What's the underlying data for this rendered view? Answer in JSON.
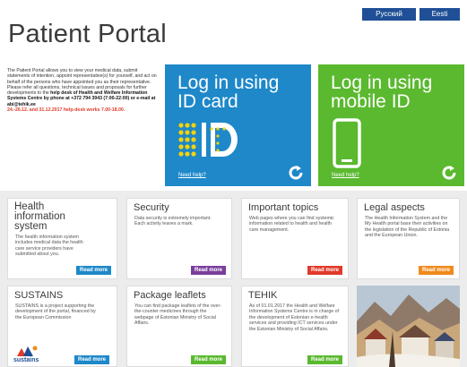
{
  "languages": {
    "russian": "Русский",
    "estonian": "Eesti"
  },
  "page_title": "Patient Portal",
  "intro": {
    "p1": "The Patient Portal allows you to view your medical data, submit statements of intention, appoint representative(s) for yourself, and act on behalf of the persons who have appointed you as their representative.",
    "p2a": "Please refer all questions, technical issues and proposals for further developments to the ",
    "p2b": "help desk of Health and Welfare Information Systems Centre by phone at +372 794 3943 (7:00-22:00) or e-mail at abi@tehik.ee",
    "p3": "24.-26.12. and 31.12.2017 help-desk works 7.00-18.00."
  },
  "login_id": {
    "line1": "Log in using",
    "line2": "ID card",
    "help": "Need help?"
  },
  "login_mobile": {
    "line1": "Log in using",
    "line2": "mobile ID",
    "help": "Need help?"
  },
  "cards": {
    "health": {
      "title1": "Health",
      "title2": "information",
      "title3": "system",
      "text": "The health information system includes medical data the health care service providers have submitted about you.",
      "read_more": "Read more"
    },
    "security": {
      "title": "Security",
      "text": "Data security is extremely important. Each activity leaves a mark.",
      "read_more": "Read more"
    },
    "topics": {
      "title": "Important topics",
      "text": "Web pages where you can find systemic information related to health and health care management.",
      "read_more": "Read more"
    },
    "legal": {
      "title": "Legal aspects",
      "text": "The Health Information System and the My Health portal base their activities on the legislation of the Republic of Estonia and the European Union.",
      "read_more": "Read more"
    },
    "sustains": {
      "title": "SUSTAINS",
      "text": "SUSTAINS is a project supporting the development of the portal, financed by the European Commission",
      "read_more": "Read more",
      "logo_text": "sustains"
    },
    "leaflets": {
      "title": "Package leaflets",
      "text": "You can find package leaflets of the over-the-counter medicines through the webpage of Estonian Ministry of Social Affairs.",
      "read_more": "Read more"
    },
    "tehik": {
      "title": "TEHIK",
      "text": "As of 01.01.2017 the Health and Welfare Information Systems Centre is in charge of the development of Estonian e-health services and providing ICT services under the Estonian Ministry of Social Affairs.",
      "read_more": "Read more"
    }
  },
  "colors": {
    "id_blue": "#1e88c9",
    "mobile_green": "#5ab92f",
    "lang_blue": "#1f4f96",
    "rm_purple": "#7a3f9b",
    "rm_red": "#e03a2a",
    "rm_orange": "#f08a1c"
  }
}
